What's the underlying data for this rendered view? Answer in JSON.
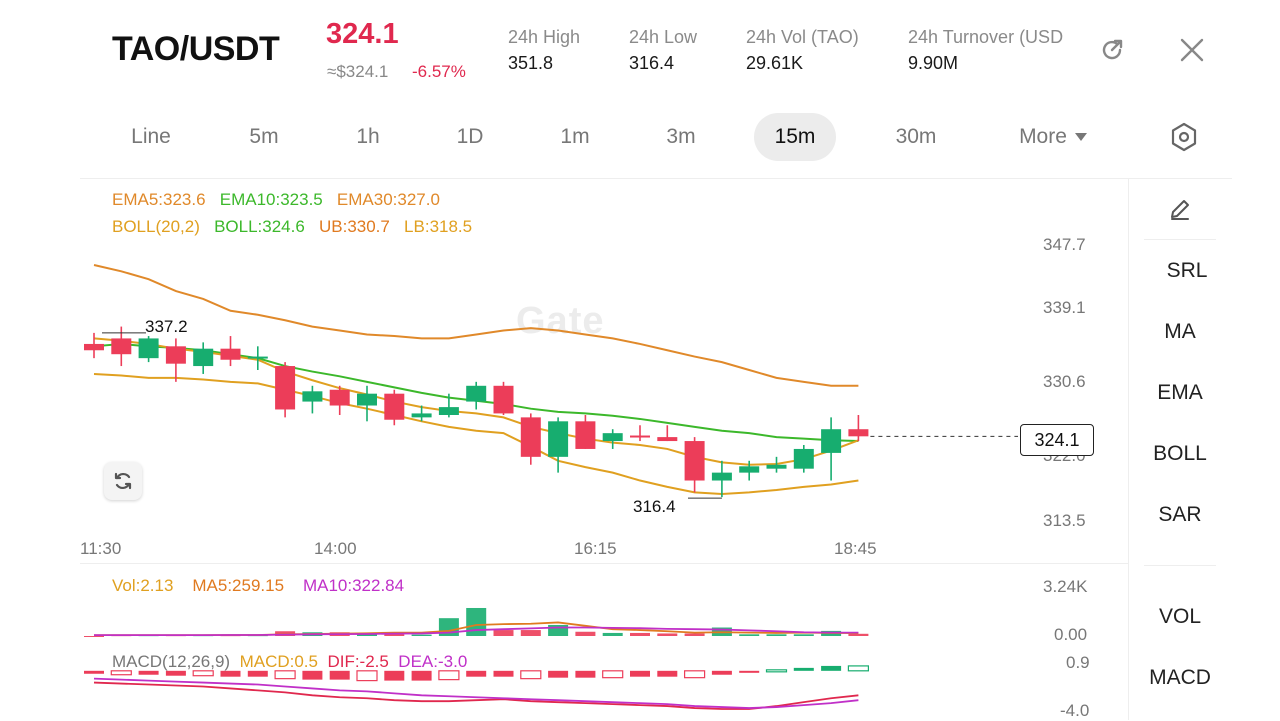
{
  "header": {
    "pair": "TAO/USDT",
    "price": "324.1",
    "usd_price": "≈$324.1",
    "change": "-6.57%",
    "stats": [
      {
        "label": "24h  High",
        "value": "351.8"
      },
      {
        "label": "24h  Low",
        "value": "316.4"
      },
      {
        "label": "24h  Vol (TAO)",
        "value": "29.61K"
      },
      {
        "label": "24h  Turnover (USD",
        "value": "9.90M"
      }
    ],
    "icons": {
      "share": "share-icon",
      "close": "close-icon"
    }
  },
  "tabs": [
    {
      "label": "Line",
      "active": false
    },
    {
      "label": "5m",
      "active": false
    },
    {
      "label": "1h",
      "active": false
    },
    {
      "label": "1D",
      "active": false
    },
    {
      "label": "1m",
      "active": false
    },
    {
      "label": "3m",
      "active": false
    },
    {
      "label": "15m",
      "active": true
    },
    {
      "label": "30m",
      "active": false
    },
    {
      "label": "More",
      "active": false
    }
  ],
  "settings_icon": "hexagon-settings-icon",
  "indicators": {
    "ema": [
      {
        "text": "EMA5:323.6",
        "color": "#e0892a"
      },
      {
        "text": "EMA10:323.5",
        "color": "#3cb82b"
      },
      {
        "text": "EMA30:327.0",
        "color": "#e0892a"
      }
    ],
    "boll": [
      {
        "text": "BOLL(20,2)",
        "color": "#e0a020"
      },
      {
        "text": "BOLL:324.6",
        "color": "#3cb82b"
      },
      {
        "text": "UB:330.7",
        "color": "#e07a20"
      },
      {
        "text": "LB:318.5",
        "color": "#e0a020"
      }
    ],
    "vol": [
      {
        "text": "Vol:2.13",
        "color": "#e0a020"
      },
      {
        "text": "MA5:259.15",
        "color": "#e07a20"
      },
      {
        "text": "MA10:322.84",
        "color": "#c030c8"
      }
    ],
    "macd": [
      {
        "text": "MACD(12,26,9)",
        "color": "#777777"
      },
      {
        "text": "MACD:0.5",
        "color": "#e0a020"
      },
      {
        "text": "DIF:-2.5",
        "color": "#e0284e"
      },
      {
        "text": "DEA:-3.0",
        "color": "#c030c8"
      }
    ]
  },
  "price_axis": [
    "347.7",
    "339.1",
    "330.6",
    "322.0",
    "313.5"
  ],
  "vol_axis": [
    "3.24K",
    "0.00"
  ],
  "macd_axis": [
    "0.9",
    "-4.0"
  ],
  "time_axis": [
    "11:30",
    "14:00",
    "16:15",
    "18:45"
  ],
  "current_price_tag": "324.1",
  "annotations": {
    "high": "337.2",
    "low": "316.4"
  },
  "watermark": "Gate",
  "side_tools": {
    "draw_icon": "pencil-icon",
    "items": [
      "SRL",
      "MA",
      "EMA",
      "BOLL",
      "SAR"
    ],
    "bottom_items": [
      "VOL",
      "MACD"
    ]
  },
  "colors": {
    "up": "#17ad6f",
    "down": "#ec3d59",
    "accent_red": "#e0284e"
  },
  "chart_data": {
    "type": "candlestick",
    "interval": "15m",
    "candles": [
      {
        "o": 335.8,
        "h": 337.2,
        "l": 334.0,
        "c": 335.0
      },
      {
        "o": 336.5,
        "h": 338.0,
        "l": 333.0,
        "c": 334.5
      },
      {
        "o": 334.0,
        "h": 336.8,
        "l": 333.5,
        "c": 336.5
      },
      {
        "o": 335.5,
        "h": 336.5,
        "l": 331.0,
        "c": 333.3
      },
      {
        "o": 333.0,
        "h": 336.0,
        "l": 332.0,
        "c": 335.2
      },
      {
        "o": 335.2,
        "h": 336.8,
        "l": 333.0,
        "c": 333.8
      },
      {
        "o": 334.0,
        "h": 335.5,
        "l": 332.5,
        "c": 334.2
      },
      {
        "o": 333.0,
        "h": 333.5,
        "l": 326.5,
        "c": 327.5
      },
      {
        "o": 328.5,
        "h": 330.5,
        "l": 327.0,
        "c": 329.8
      },
      {
        "o": 330.0,
        "h": 330.5,
        "l": 326.8,
        "c": 328.0
      },
      {
        "o": 328.0,
        "h": 330.5,
        "l": 326.0,
        "c": 329.5
      },
      {
        "o": 329.5,
        "h": 330.0,
        "l": 325.5,
        "c": 326.2
      },
      {
        "o": 326.5,
        "h": 328.0,
        "l": 326.0,
        "c": 327.0
      },
      {
        "o": 326.8,
        "h": 329.5,
        "l": 326.5,
        "c": 327.8
      },
      {
        "o": 328.5,
        "h": 331.0,
        "l": 327.5,
        "c": 330.5
      },
      {
        "o": 330.5,
        "h": 331.0,
        "l": 326.8,
        "c": 327.0
      },
      {
        "o": 326.5,
        "h": 327.0,
        "l": 320.5,
        "c": 321.5
      },
      {
        "o": 321.5,
        "h": 326.5,
        "l": 319.5,
        "c": 326.0
      },
      {
        "o": 326.0,
        "h": 326.8,
        "l": 322.5,
        "c": 322.5
      },
      {
        "o": 323.5,
        "h": 325.0,
        "l": 322.5,
        "c": 324.5
      },
      {
        "o": 324.2,
        "h": 325.5,
        "l": 323.5,
        "c": 324.0
      },
      {
        "o": 324.0,
        "h": 325.5,
        "l": 323.5,
        "c": 323.5
      },
      {
        "o": 323.5,
        "h": 324.0,
        "l": 317.0,
        "c": 318.5
      },
      {
        "o": 318.5,
        "h": 321.0,
        "l": 316.4,
        "c": 319.5
      },
      {
        "o": 319.5,
        "h": 321.0,
        "l": 318.5,
        "c": 320.3
      },
      {
        "o": 320.0,
        "h": 321.5,
        "l": 319.5,
        "c": 320.5
      },
      {
        "o": 320.0,
        "h": 323.0,
        "l": 319.5,
        "c": 322.5
      },
      {
        "o": 322.0,
        "h": 326.5,
        "l": 318.5,
        "c": 325.0
      },
      {
        "o": 325.0,
        "h": 326.8,
        "l": 323.5,
        "c": 324.1
      }
    ],
    "ema_upper": [
      345.8,
      345.0,
      344.0,
      342.5,
      341.5,
      340.0,
      339.5,
      338.8,
      338.0,
      337.5,
      337.0,
      336.8,
      336.5,
      336.5,
      337.0,
      337.5,
      337.8,
      337.5,
      337.0,
      336.5,
      335.8,
      335.0,
      334.2,
      333.5,
      332.5,
      331.5,
      331.0,
      330.5,
      330.5
    ],
    "ema_mid": [
      335.5,
      335.8,
      335.5,
      335.3,
      335.0,
      334.5,
      334.0,
      333.0,
      332.3,
      331.7,
      331.0,
      330.3,
      329.6,
      329.0,
      328.6,
      328.2,
      327.6,
      327.2,
      327.0,
      326.7,
      326.3,
      325.8,
      325.3,
      324.8,
      324.5,
      324.0,
      323.8,
      323.6,
      323.5
    ],
    "ema_fast": [
      336.5,
      336.2,
      335.8,
      335.2,
      334.8,
      334.3,
      333.8,
      332.3,
      331.2,
      330.2,
      329.4,
      328.5,
      327.8,
      327.3,
      327.0,
      326.5,
      325.3,
      324.5,
      323.8,
      323.3,
      323.0,
      322.5,
      321.5,
      320.8,
      320.5,
      320.6,
      321.2,
      322.3,
      323.6
    ],
    "boll_lb": [
      332.0,
      331.8,
      331.5,
      331.5,
      331.3,
      331.0,
      330.8,
      330.0,
      329.2,
      328.3,
      327.6,
      326.8,
      326.0,
      325.3,
      324.8,
      324.5,
      322.8,
      321.0,
      320.2,
      319.5,
      318.5,
      317.7,
      317.0,
      316.8,
      317.0,
      317.3,
      317.7,
      318.0,
      318.5
    ],
    "volume": [
      {
        "v": 0.0,
        "up": false
      },
      {
        "v": 0.05,
        "up": false
      },
      {
        "v": 0.05,
        "up": true
      },
      {
        "v": 0.05,
        "up": false
      },
      {
        "v": 0.05,
        "up": true
      },
      {
        "v": 0.05,
        "up": false
      },
      {
        "v": 0.05,
        "up": true
      },
      {
        "v": 0.28,
        "up": false
      },
      {
        "v": 0.22,
        "up": true
      },
      {
        "v": 0.22,
        "up": false
      },
      {
        "v": 0.2,
        "up": true
      },
      {
        "v": 0.22,
        "up": false
      },
      {
        "v": 0.08,
        "up": true
      },
      {
        "v": 1.05,
        "up": true
      },
      {
        "v": 1.65,
        "up": true
      },
      {
        "v": 0.35,
        "up": false
      },
      {
        "v": 0.35,
        "up": false
      },
      {
        "v": 0.65,
        "up": true
      },
      {
        "v": 0.25,
        "up": false
      },
      {
        "v": 0.18,
        "up": true
      },
      {
        "v": 0.18,
        "up": false
      },
      {
        "v": 0.15,
        "up": false
      },
      {
        "v": 0.15,
        "up": false
      },
      {
        "v": 0.5,
        "up": true
      },
      {
        "v": 0.1,
        "up": true
      },
      {
        "v": 0.1,
        "up": true
      },
      {
        "v": 0.1,
        "up": true
      },
      {
        "v": 0.3,
        "up": true
      },
      {
        "v": 0.13,
        "up": false
      }
    ],
    "vol_ma5": [
      0.05,
      0.05,
      0.05,
      0.05,
      0.05,
      0.06,
      0.06,
      0.1,
      0.12,
      0.14,
      0.16,
      0.2,
      0.2,
      0.3,
      0.65,
      0.7,
      0.72,
      0.8,
      0.6,
      0.4,
      0.35,
      0.28,
      0.2,
      0.22,
      0.2,
      0.18,
      0.2,
      0.18,
      0.17
    ],
    "vol_ma10": [
      0.05,
      0.05,
      0.05,
      0.05,
      0.05,
      0.06,
      0.06,
      0.08,
      0.1,
      0.11,
      0.12,
      0.14,
      0.15,
      0.2,
      0.35,
      0.4,
      0.45,
      0.5,
      0.5,
      0.48,
      0.46,
      0.42,
      0.4,
      0.38,
      0.33,
      0.28,
      0.22,
      0.2,
      0.2
    ],
    "macd_hist": [
      -0.3,
      -0.4,
      -0.4,
      -0.5,
      -0.5,
      -0.6,
      -0.6,
      -0.8,
      -0.9,
      -0.9,
      -1.0,
      -1.0,
      -1.0,
      -0.9,
      -0.6,
      -0.6,
      -0.8,
      -0.7,
      -0.7,
      -0.7,
      -0.6,
      -0.6,
      -0.7,
      -0.4,
      -0.2,
      0.1,
      0.3,
      0.5,
      0.5
    ],
    "macd_dif": [
      -1.2,
      -1.3,
      -1.4,
      -1.5,
      -1.6,
      -1.8,
      -2.0,
      -2.2,
      -2.5,
      -2.7,
      -2.8,
      -3.0,
      -3.1,
      -3.1,
      -3.0,
      -2.9,
      -3.1,
      -3.2,
      -3.3,
      -3.4,
      -3.5,
      -3.6,
      -3.8,
      -3.9,
      -3.9,
      -3.6,
      -3.2,
      -2.8,
      -2.5
    ],
    "macd_dea": [
      -0.8,
      -0.9,
      -1.0,
      -1.1,
      -1.2,
      -1.3,
      -1.4,
      -1.6,
      -1.8,
      -2.0,
      -2.1,
      -2.3,
      -2.5,
      -2.6,
      -2.7,
      -2.8,
      -2.9,
      -3.0,
      -3.1,
      -3.2,
      -3.3,
      -3.4,
      -3.6,
      -3.7,
      -3.8,
      -3.7,
      -3.5,
      -3.3,
      -3.0
    ],
    "price_range": [
      313.5,
      347.7
    ],
    "vol_range": [
      0.0,
      3.24
    ],
    "macd_range": [
      -4.0,
      0.9
    ]
  }
}
